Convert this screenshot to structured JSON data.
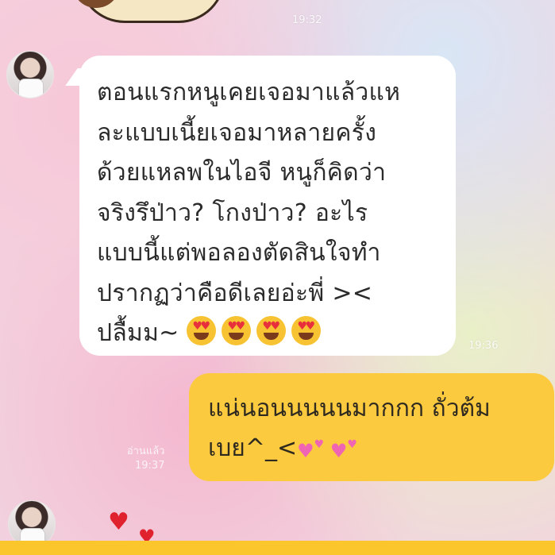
{
  "chat": {
    "top_time": "19:32",
    "incoming": {
      "lines": [
        "ตอนแรกหนูเคยเจอมาแล้วแห",
        "ละแบบเนี้ยเจอมาหลายครั้ง",
        "ด้วยแหลพในไอจี หนูก็คิดว่า",
        "จริงรึป่าว? โกงป่าว? อะไร",
        "แบบนี้แต่พอลองตัดสินใจทำ",
        "ปรากฏว่าคือดีเลยอ่ะพี่ ><",
        "ปลื้มม~"
      ],
      "emoji": [
        "heart-eyes-emoji",
        "heart-eyes-emoji",
        "heart-eyes-emoji",
        "heart-eyes-emoji"
      ],
      "time": "19:36"
    },
    "outgoing": {
      "lines": [
        "แน่นอนนนนนมากกก ถั่วต้ม",
        "เบย^_<"
      ],
      "read_label": "อ่านแล้ว",
      "time": "19:37"
    }
  },
  "colors": {
    "incoming_bubble": "#ffffff",
    "outgoing_bubble": "#fcca3f",
    "heart": "#e0212e"
  }
}
